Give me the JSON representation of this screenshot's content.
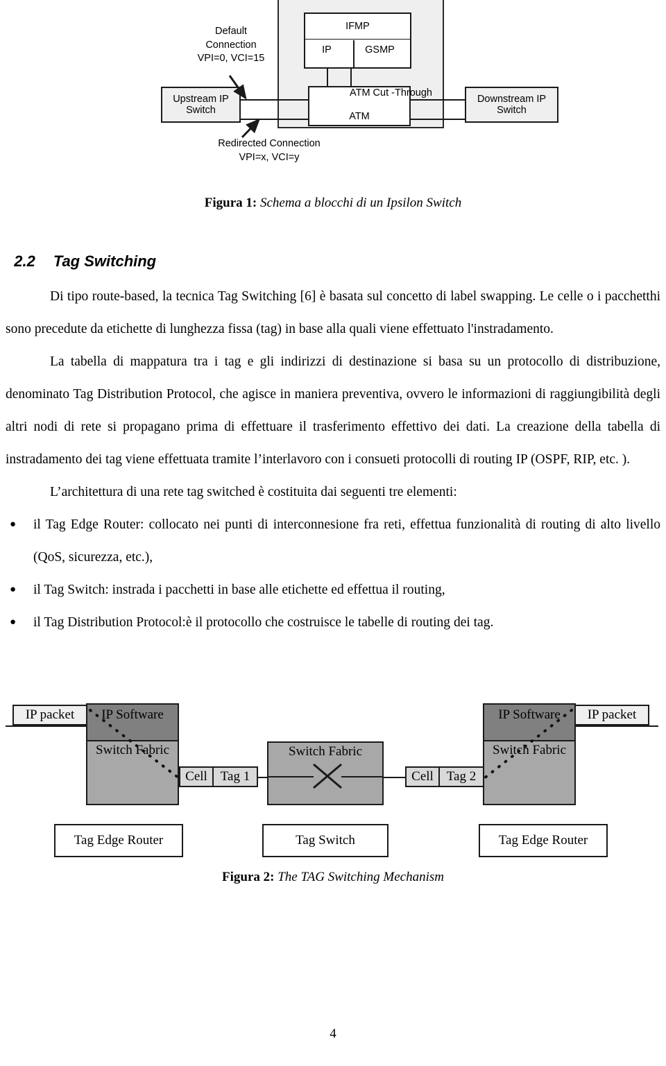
{
  "page": {
    "number": "4"
  },
  "figure1": {
    "caption_label": "Figura 1:",
    "caption_text": "Schema a blocchi di un Ipsilon Switch",
    "boxes": {
      "upstream": "Upstream IP\nSwitch",
      "downstream": "Downstream IP\nSwitch",
      "ifmp": "IFMP",
      "ip": "IP",
      "gsmp": "GSMP",
      "atm": "ATM",
      "cut_through": "ATM Cut -Through"
    },
    "annotations": {
      "default_connection": "Default\nConnection\nVPI=0, VCI=15",
      "redirected_connection": "Redirected Connection\nVPI=x, VCI=y"
    }
  },
  "section": {
    "number": "2.2",
    "title": "Tag Switching"
  },
  "paragraphs": {
    "p1": {
      "parts": [
        {
          "t": "Di tipo ",
          "i": false
        },
        {
          "t": "route-based",
          "i": true
        },
        {
          "t": ", la tecnica ",
          "i": false
        },
        {
          "t": "Tag Switching",
          "i": true
        },
        {
          "t": " [6] è basata sul concetto di ",
          "i": false
        },
        {
          "t": "label swapping",
          "i": true
        },
        {
          "t": ". Le celle o i pacchetthi sono precedute da etichette di lunghezza fissa (",
          "i": false
        },
        {
          "t": "tag",
          "i": true
        },
        {
          "t": ") in base alla quali viene effettuato l'instradamento.",
          "i": false
        }
      ]
    },
    "p2": {
      "parts": [
        {
          "t": "La tabella di mappatura tra i ",
          "i": false
        },
        {
          "t": "tag",
          "i": true
        },
        {
          "t": " e gli indirizzi di destinazione si basa su un protocollo di distribuzione, denominato ",
          "i": false
        },
        {
          "t": "Tag Distribution Protocol",
          "i": true
        },
        {
          "t": ", che agisce in maniera preventiva, ovvero le informazioni di raggiungibilità degli altri nodi di rete si propagano prima di effettuare il trasferimento effettivo dei dati. La creazione della tabella di instradamento dei ",
          "i": false
        },
        {
          "t": "tag",
          "i": true
        },
        {
          "t": " viene effettuata tramite l’interlavoro con i consueti protocolli di ",
          "i": false
        },
        {
          "t": "routing",
          "i": true
        },
        {
          "t": " IP (OSPF, RIP, etc. ).",
          "i": false
        }
      ]
    },
    "p3": {
      "parts": [
        {
          "t": "L’architettura di una rete ",
          "i": false
        },
        {
          "t": "tag switched",
          "i": true
        },
        {
          "t": " è costituita dai seguenti tre elementi:",
          "i": false
        }
      ]
    }
  },
  "bullets": [
    {
      "parts": [
        {
          "t": "il ",
          "i": false
        },
        {
          "t": "Tag Edge Router",
          "i": true
        },
        {
          "t": ": collocato nei punti di interconnesione fra reti, effettua funzionalità di ",
          "i": false
        },
        {
          "t": "routing",
          "i": true
        },
        {
          "t": " di alto livello (QoS, sicurezza, etc.),",
          "i": false
        }
      ]
    },
    {
      "parts": [
        {
          "t": "il ",
          "i": false
        },
        {
          "t": "Tag Switch",
          "i": true
        },
        {
          "t": ": instrada i pacchetti in base alle etichette ed effettua il ",
          "i": false
        },
        {
          "t": "routing",
          "i": true
        },
        {
          "t": ",",
          "i": false
        }
      ]
    },
    {
      "parts": [
        {
          "t": "il ",
          "i": false
        },
        {
          "t": "Tag Distribution Protocol",
          "i": true
        },
        {
          "t": ":è il protocollo che costruisce le tabelle di ",
          "i": false
        },
        {
          "t": "routing",
          "i": true
        },
        {
          "t": " dei ",
          "i": false
        },
        {
          "t": "tag",
          "i": true
        },
        {
          "t": ".",
          "i": false
        }
      ]
    }
  ],
  "figure2": {
    "caption_label": "Figura 2:",
    "caption_text": "The TAG Switching Mechanism",
    "ip_packet_left": "IP packet",
    "ip_packet_right": "IP packet",
    "nodes": [
      {
        "ip_software": "IP Software",
        "switch_fabric": "Switch Fabric",
        "name": "Tag Edge Router"
      },
      {
        "switch_fabric": "Switch Fabric",
        "name": "Tag Switch"
      },
      {
        "ip_software": "IP Software",
        "switch_fabric": "Switch Fabric",
        "name": "Tag Edge Router"
      }
    ],
    "cells": [
      {
        "left": "Cell",
        "right": "Tag 1"
      },
      {
        "left": "Cell",
        "right": "Tag 2"
      }
    ],
    "colors": {
      "ip_software_fill": "#808080",
      "switch_fabric_fill": "#a8a8a8",
      "packet_fill": "#efefef",
      "cell_fill": "#d9d9d9"
    }
  }
}
